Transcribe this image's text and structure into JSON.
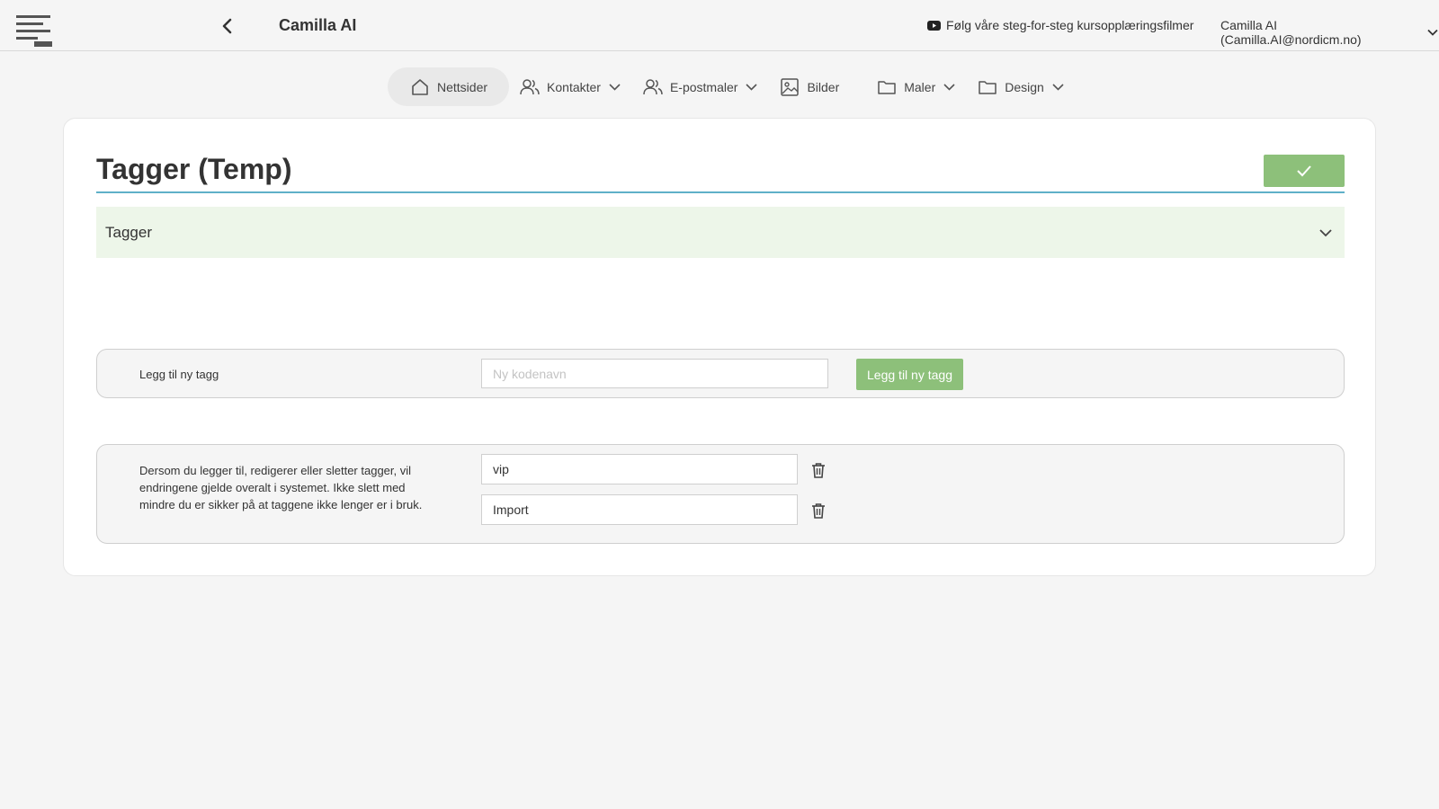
{
  "header": {
    "app_title": "Camilla AI",
    "tutorial_link": "Følg våre steg-for-steg kursopplæringsfilmer",
    "user": "Camilla AI (Camilla.AI@nordicm.no)"
  },
  "nav": {
    "items": [
      {
        "label": "Nettsider",
        "icon": "home-icon",
        "active": true
      },
      {
        "label": "Kontakter",
        "icon": "users-icon",
        "dropdown": true
      },
      {
        "label": "E-postmaler",
        "icon": "users-icon",
        "dropdown": true
      },
      {
        "label": "Bilder",
        "icon": "image-icon"
      },
      {
        "label": "Maler",
        "icon": "folder-icon",
        "dropdown": true
      },
      {
        "label": "Design",
        "icon": "folder-icon",
        "dropdown": true
      }
    ]
  },
  "main": {
    "title": "Tagger (Temp)",
    "accordion_label": "Tagger",
    "add_tag": {
      "label": "Legg til ny tagg",
      "placeholder": "Ny kodenavn",
      "button": "Legg til ny tagg"
    },
    "notice": "Dersom du legger til, redigerer eller sletter tagger, vil endringene gjelde overalt i systemet. Ikke slett med mindre du er sikker på at taggene ikke lenger er i bruk.",
    "tags": [
      "vip",
      "Import"
    ]
  },
  "colors": {
    "accent_green": "#8dc07a",
    "accordion_bg": "#edf6e9",
    "underline_blue": "#5fb0c8"
  }
}
